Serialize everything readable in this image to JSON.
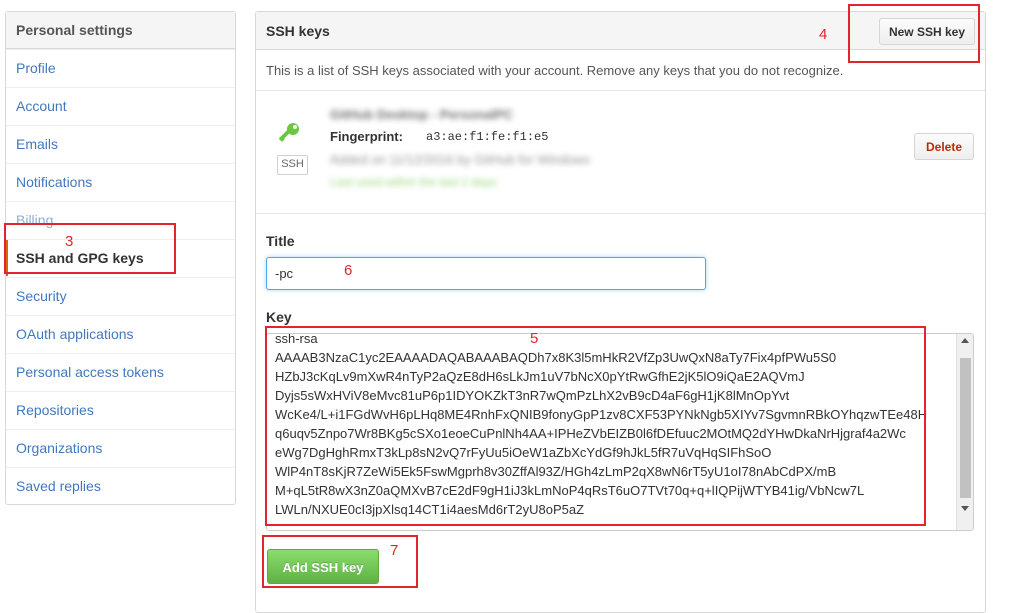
{
  "sidebar": {
    "header": "Personal settings",
    "items": [
      {
        "label": "Profile"
      },
      {
        "label": "Account"
      },
      {
        "label": "Emails"
      },
      {
        "label": "Notifications"
      },
      {
        "label": "Billing"
      },
      {
        "label": "SSH and GPG keys",
        "selected": true
      },
      {
        "label": "Security"
      },
      {
        "label": "OAuth applications"
      },
      {
        "label": "Personal access tokens"
      },
      {
        "label": "Repositories"
      },
      {
        "label": "Organizations"
      },
      {
        "label": "Saved replies"
      }
    ]
  },
  "ssh_keys": {
    "title": "SSH keys",
    "new_key_button": "New SSH key",
    "intro": "This is a list of SSH keys associated with your account. Remove any keys that you do not recognize.",
    "existing_key": {
      "name": "GitHub Desktop - PersonalPC",
      "fingerprint_label": "Fingerprint:",
      "fingerprint_value": "a3:ae:f1:fe:f1:e5",
      "added": "Added on 11/12/2016 by GitHub for Windows",
      "usage": "Last used within the last 2 days",
      "badge": "SSH",
      "delete_button": "Delete"
    },
    "form": {
      "title_label": "Title",
      "title_value": "-pc",
      "key_label": "Key",
      "key_value": "ssh-rsa\nAAAAB3NzaC1yc2EAAAADAQABAAABAQDh7x8K3l5mHkR2VfZp3UwQxN8aTy7Fix4pfPWu5S0\nHZbJ3cKqLv9mXwR4nTyP2aQzE8dH6sLkJm1uV7bNcX0pYtRwGfhE2jK5lO9iQaE2AQVmJ\nDyjs5sWxHViV8eMvc81uP6p1IDYOKZkT3nR7wQmPzLhX2vB9cD4aF6gH1jK8lMnOpYvt\nWcKe4/L+i1FGdWvH6pLHq8ME4RnhFxQNIB9fonyGpP1zv8CXF53PYNkNgb5XIYv7SgvmnRBkOYhqzwTEe48H\nq6uqv5Znpo7Wr8BKg5cSXo1eoeCuPnlNh4AA+IPHeZVbEIZB0l6fDEfuuc2MOtMQ2dYHwDkaNrHjgraf4a2Wc\neWg7DgHghRmxT3kLp8sN2vQ7rFyUu5iOeW1aZbXcYdGf9hJkL5fR7uVqHqSIFhSoO\nWlP4nT8sKjR7ZeWi5Ek5FswMgprh8v30ZffAl93Z/HGh4zLmP2qX8wN6rT5yU1oI78nAbCdPX/mB\nM+qL5tR8wX3nZ0aQMXvB7cE2dF9gH1iJ3kLmNoP4qRsT6uO7TVt70q+q+lIQPijWTYB41ig/VbNcw7L\nLWLn/NXUE0cI3jpXlsq14CT1i4aesMd6rT2yU8oP5aZ"
    },
    "add_button": "Add SSH key"
  },
  "annotations": [
    "3",
    "4",
    "5",
    "6",
    "7"
  ],
  "colors": {
    "link": "#4078c0",
    "annotation": "#e0262c",
    "selected_bar": "#d26911",
    "add_button": "#60b044",
    "delete_text": "#bd2c00"
  },
  "icons": {
    "key_icon": "key-icon"
  }
}
